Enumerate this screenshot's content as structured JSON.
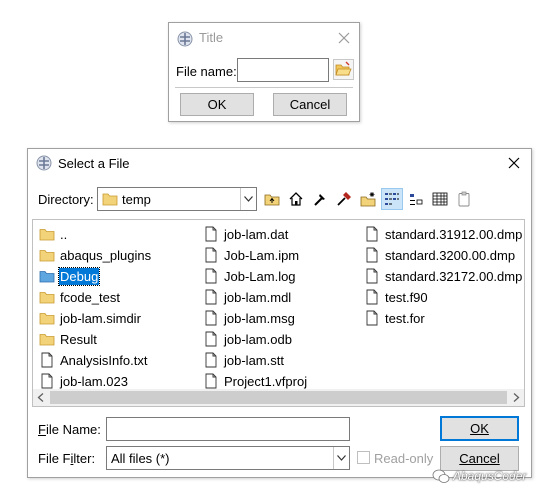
{
  "small_dialog": {
    "title": "Title",
    "file_name_label": "File name:",
    "file_name_value": "",
    "ok_label": "OK",
    "cancel_label": "Cancel"
  },
  "select_dialog": {
    "title": "Select a File",
    "directory_label": "Directory:",
    "directory_value": "temp",
    "files": [
      {
        "name": "..",
        "type": "folder"
      },
      {
        "name": "abaqus_plugins",
        "type": "folder"
      },
      {
        "name": "Debug",
        "type": "folder",
        "selected": true
      },
      {
        "name": "fcode_test",
        "type": "folder"
      },
      {
        "name": "job-lam.simdir",
        "type": "folder"
      },
      {
        "name": "Result",
        "type": "folder"
      },
      {
        "name": "AnalysisInfo.txt",
        "type": "file"
      },
      {
        "name": "job-lam.023",
        "type": "file"
      },
      {
        "name": "job-lam.dat",
        "type": "file"
      },
      {
        "name": "Job-Lam.ipm",
        "type": "file"
      },
      {
        "name": "Job-Lam.log",
        "type": "file"
      },
      {
        "name": "job-lam.mdl",
        "type": "file"
      },
      {
        "name": "job-lam.msg",
        "type": "file"
      },
      {
        "name": "job-lam.odb",
        "type": "file"
      },
      {
        "name": "job-lam.stt",
        "type": "file"
      },
      {
        "name": "Project1.vfproj",
        "type": "file"
      },
      {
        "name": "standard.31912.00.dmp",
        "type": "file"
      },
      {
        "name": "standard.3200.00.dmp",
        "type": "file"
      },
      {
        "name": "standard.32172.00.dmp",
        "type": "file"
      },
      {
        "name": "test.f90",
        "type": "file"
      },
      {
        "name": "test.for",
        "type": "file"
      }
    ],
    "file_name_label_pre": "F",
    "file_name_label_post": "ile Name:",
    "file_name_value": "",
    "ok_label": "OK",
    "filter_label_pre": "File F",
    "filter_label_u": "i",
    "filter_label_post": "lter:",
    "filter_value": "All files (*)",
    "readonly_label": "Read-only",
    "cancel_label": "Cancel"
  },
  "watermark": "AbaqusCoder",
  "colors": {
    "accent": "#0078d7",
    "folder": "#f3d37a",
    "folder_selected": "#5ea6e0"
  }
}
